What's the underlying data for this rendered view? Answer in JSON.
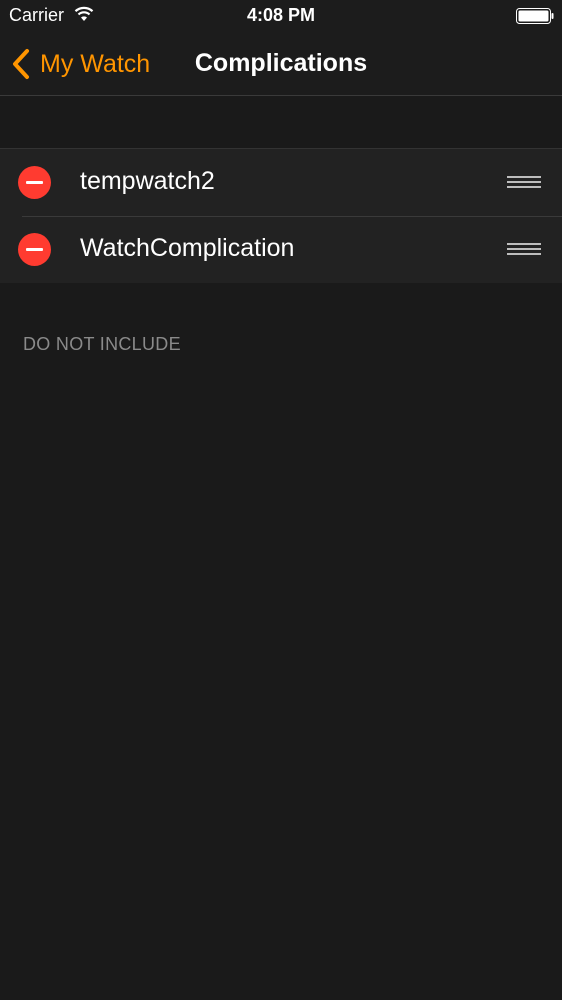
{
  "status_bar": {
    "carrier": "Carrier",
    "time": "4:08 PM"
  },
  "nav": {
    "back_label": "My Watch",
    "title": "Complications"
  },
  "list": {
    "items": [
      {
        "label": "tempwatch2"
      },
      {
        "label": "WatchComplication"
      }
    ]
  },
  "section": {
    "do_not_include_header": "DO NOT INCLUDE"
  },
  "colors": {
    "accent": "#ff9500",
    "delete": "#ff3b30",
    "background": "#1a1a1a"
  }
}
